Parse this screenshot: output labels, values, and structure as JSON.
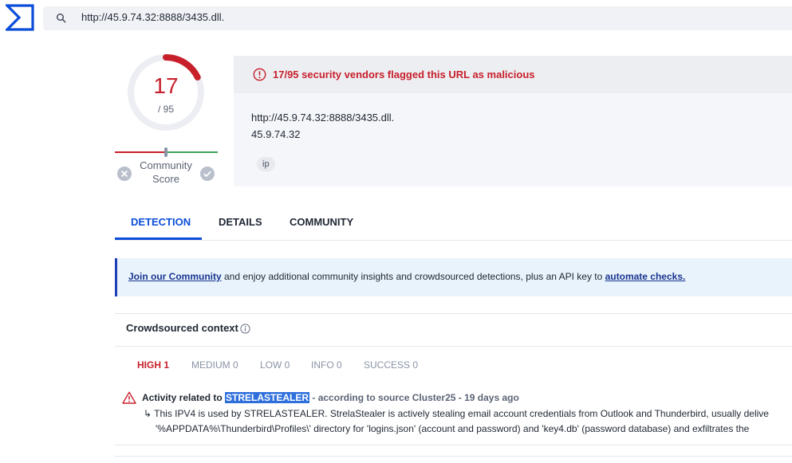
{
  "header": {
    "search_value": "http://45.9.74.32:8888/3435.dll."
  },
  "score": {
    "detections": 17,
    "total": 95,
    "detections_label": "17",
    "total_label": "/ 95",
    "community_label_1": "Community",
    "community_label_2": "Score"
  },
  "summary": {
    "alert_text": "17/95 security vendors flagged this URL as malicious",
    "url": "http://45.9.74.32:8888/3435.dll.",
    "ip": "45.9.74.32",
    "tag": "ip"
  },
  "tabs": [
    {
      "label": "DETECTION",
      "active": true
    },
    {
      "label": "DETAILS",
      "active": false
    },
    {
      "label": "COMMUNITY",
      "active": false
    }
  ],
  "banner": {
    "link1": "Join our Community",
    "middle": " and enjoy additional community insights and crowdsourced detections, plus an API key to ",
    "link2": "automate checks."
  },
  "crowdsourced": {
    "title": "Crowdsourced context",
    "severity_tabs": [
      "HIGH 1",
      "MEDIUM 0",
      "LOW 0",
      "INFO 0",
      "SUCCESS 0"
    ],
    "item": {
      "prefix": "Activity related to ",
      "highlight": "STRELASTEALER",
      "source": " - according to source Cluster25 - 19 days ago",
      "line1": "↳ This IPV4 is used by STRELASTEALER. StrelaStealer is actively stealing email account credentials from Outlook and Thunderbird, usually delive",
      "line2": "'%APPDATA%\\Thunderbird\\Profiles\\' directory for 'logins.json' (account and password) and 'key4.db' (password database) and exfiltrates the"
    }
  },
  "colors": {
    "malicious": "#c7202b",
    "accent": "#0b4dda",
    "positive": "#3da25a"
  }
}
